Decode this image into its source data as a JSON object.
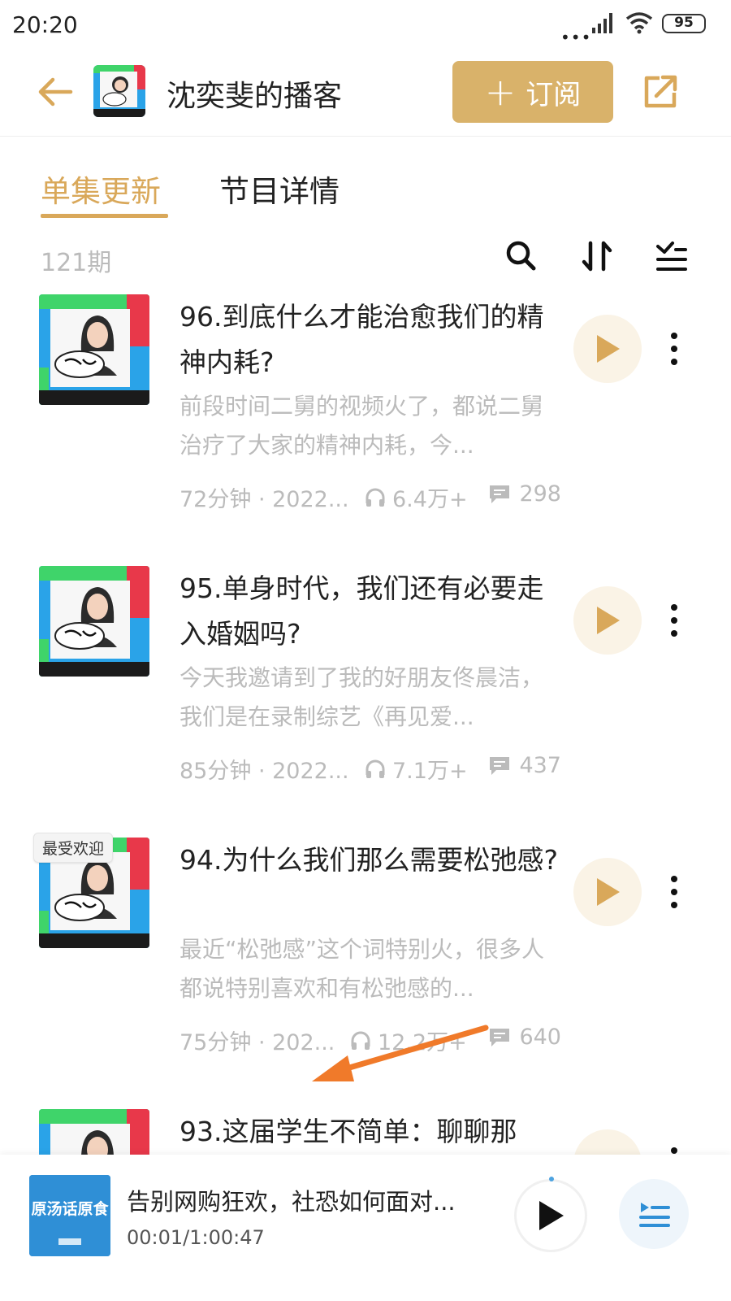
{
  "status_bar": {
    "time": "20:20",
    "dots": "•••",
    "battery": "95"
  },
  "header": {
    "title": "沈奕斐的播客",
    "subscribe_label": "订阅",
    "subscribe_plus": "+"
  },
  "tabs": [
    {
      "label": "单集更新"
    },
    {
      "label": "节目详情"
    }
  ],
  "list": {
    "count": "121期"
  },
  "episodes": [
    {
      "title": "96.到底什么才能治愈我们的精神内耗?",
      "description": "前段时间二舅的视频火了，都说二舅治疗了大家的精神内耗，今...",
      "duration": "72分钟 · 2022...",
      "plays": "6.4万+",
      "comments": "298",
      "badge": ""
    },
    {
      "title": "95.单身时代，我们还有必要走入婚姻吗?",
      "description": "今天我邀请到了我的好朋友佟晨洁，我们是在录制综艺《再见爱...",
      "duration": "85分钟 · 2022...",
      "plays": "7.1万+",
      "comments": "437",
      "badge": ""
    },
    {
      "title": "94.为什么我们那么需要松弛感?",
      "description": "最近“松弛感”这个词特别火，很多人都说特别喜欢和有松弛感的...",
      "duration": "75分钟 · 202...",
      "plays": "12.2万+",
      "comments": "640",
      "badge": "最受欢迎"
    },
    {
      "title": "93.这届学生不简单：聊聊那",
      "description": "",
      "duration": "",
      "plays": "",
      "comments": "",
      "badge": ""
    }
  ],
  "player": {
    "title": "告别网购狂欢，社恐如何面对...",
    "time": "00:01/1:00:47",
    "cover_text": "原汤话原食"
  },
  "colors": {
    "accent": "#d9a85a",
    "subscribe_bg": "#d9b26a",
    "muted": "#bbbbbb",
    "annotation_arrow": "#f07a2a"
  },
  "icons": {
    "back": "back-arrow-icon",
    "share": "share-icon",
    "search": "search-icon",
    "sort": "sort-icon",
    "filter": "filter-list-icon",
    "play": "play-icon",
    "more": "more-vertical-icon",
    "headphones": "headphones-icon",
    "comment": "comment-icon",
    "playlist": "playlist-icon"
  }
}
